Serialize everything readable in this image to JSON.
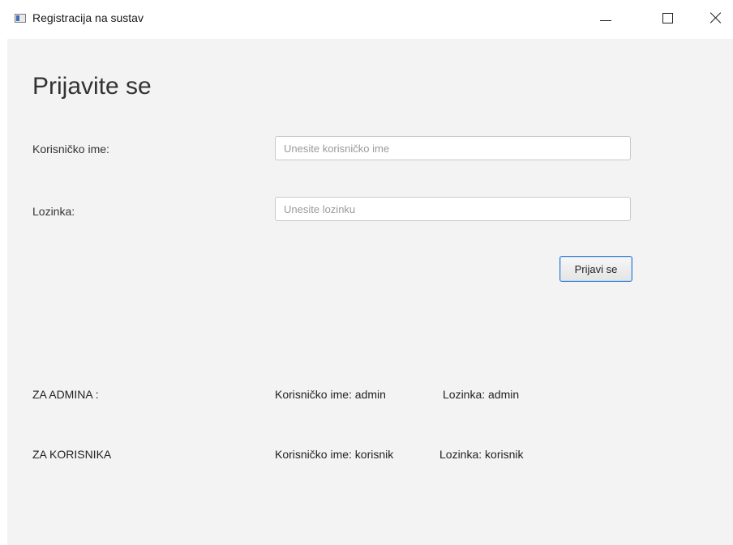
{
  "window": {
    "title": "Registracija na sustav",
    "controls": [
      "minimize",
      "maximize",
      "close"
    ]
  },
  "form": {
    "heading": "Prijavite se",
    "username_label": "Korisničko ime:",
    "username_placeholder": "Unesite korisničko ime",
    "username_value": "",
    "password_label": "Lozinka:",
    "password_placeholder": "Unesite lozinku",
    "password_value": "",
    "login_button": "Prijavi se"
  },
  "credentials": {
    "admin": {
      "label": "ZA ADMINA :",
      "username": "Korisničko ime: admin",
      "password": "Lozinka: admin"
    },
    "user": {
      "label": "ZA KORISNIKA",
      "username": "Korisničko ime: korisnik",
      "password": "Lozinka: korisnik"
    }
  },
  "colors": {
    "background": "#f3f3f3",
    "button_focus_border": "#2e7bd0",
    "input_border": "#c8c8c8"
  }
}
